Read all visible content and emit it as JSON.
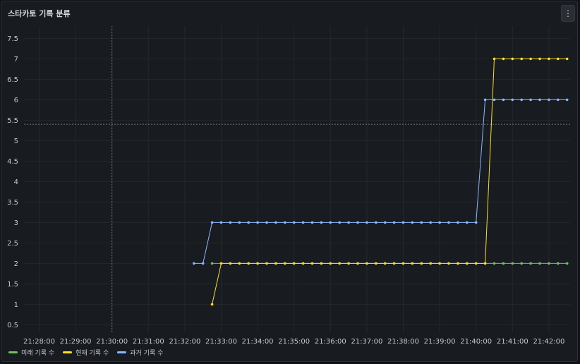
{
  "panel": {
    "title": "스타카토 기록 분류",
    "menu_icon": "more-vertical-icon",
    "menu_glyph": "⋮"
  },
  "chart_data": {
    "type": "line",
    "title": "스타카토 기록 분류",
    "xlabel": "",
    "ylabel": "",
    "x_ticks": [
      "21:28:00",
      "21:29:00",
      "21:30:00",
      "21:31:00",
      "21:32:00",
      "21:33:00",
      "21:34:00",
      "21:35:00",
      "21:36:00",
      "21:37:00",
      "21:38:00",
      "21:39:00",
      "21:40:00",
      "21:41:00",
      "21:42:00"
    ],
    "y_ticks": [
      "0.5",
      "1",
      "1.5",
      "2",
      "2.5",
      "3",
      "3.5",
      "4",
      "4.5",
      "5",
      "5.5",
      "6",
      "6.5",
      "7",
      "7.5"
    ],
    "ylim": [
      0.3,
      7.8
    ],
    "xlim": [
      "21:27:35",
      "21:42:35"
    ],
    "grid": true,
    "legend_position": "bottom-left",
    "series": [
      {
        "name": "미래 기록 수",
        "color": "#73bf69",
        "points": [
          [
            "21:32:45",
            2
          ],
          [
            "21:40:15",
            2
          ],
          [
            "21:40:30",
            2
          ],
          [
            "21:40:45",
            2
          ],
          [
            "21:41:00",
            2
          ],
          [
            "21:41:15",
            2
          ],
          [
            "21:41:30",
            2
          ],
          [
            "21:41:45",
            2
          ],
          [
            "21:42:00",
            2
          ],
          [
            "21:42:15",
            2
          ],
          [
            "21:42:30",
            2
          ]
        ]
      },
      {
        "name": "현재 기록 수",
        "color": "#fade2a",
        "points": [
          [
            "21:32:45",
            1
          ],
          [
            "21:33:00",
            2
          ],
          [
            "21:33:15",
            2
          ],
          [
            "21:33:30",
            2
          ],
          [
            "21:33:45",
            2
          ],
          [
            "21:34:00",
            2
          ],
          [
            "21:34:15",
            2
          ],
          [
            "21:34:30",
            2
          ],
          [
            "21:34:45",
            2
          ],
          [
            "21:35:00",
            2
          ],
          [
            "21:35:15",
            2
          ],
          [
            "21:35:30",
            2
          ],
          [
            "21:35:45",
            2
          ],
          [
            "21:36:00",
            2
          ],
          [
            "21:36:15",
            2
          ],
          [
            "21:36:30",
            2
          ],
          [
            "21:36:45",
            2
          ],
          [
            "21:37:00",
            2
          ],
          [
            "21:37:15",
            2
          ],
          [
            "21:37:30",
            2
          ],
          [
            "21:37:45",
            2
          ],
          [
            "21:38:00",
            2
          ],
          [
            "21:38:15",
            2
          ],
          [
            "21:38:30",
            2
          ],
          [
            "21:38:45",
            2
          ],
          [
            "21:39:00",
            2
          ],
          [
            "21:39:15",
            2
          ],
          [
            "21:39:30",
            2
          ],
          [
            "21:39:45",
            2
          ],
          [
            "21:40:00",
            2
          ],
          [
            "21:40:15",
            2
          ],
          [
            "21:40:30",
            7
          ],
          [
            "21:40:45",
            7
          ],
          [
            "21:41:00",
            7
          ],
          [
            "21:41:15",
            7
          ],
          [
            "21:41:30",
            7
          ],
          [
            "21:41:45",
            7
          ],
          [
            "21:42:00",
            7
          ],
          [
            "21:42:15",
            7
          ],
          [
            "21:42:30",
            7
          ]
        ]
      },
      {
        "name": "과거 기록 수",
        "color": "#8ab8ff",
        "points": [
          [
            "21:32:15",
            2
          ],
          [
            "21:32:30",
            2
          ],
          [
            "21:32:45",
            3
          ],
          [
            "21:33:00",
            3
          ],
          [
            "21:33:15",
            3
          ],
          [
            "21:33:30",
            3
          ],
          [
            "21:33:45",
            3
          ],
          [
            "21:34:00",
            3
          ],
          [
            "21:34:15",
            3
          ],
          [
            "21:34:30",
            3
          ],
          [
            "21:34:45",
            3
          ],
          [
            "21:35:00",
            3
          ],
          [
            "21:35:15",
            3
          ],
          [
            "21:35:30",
            3
          ],
          [
            "21:35:45",
            3
          ],
          [
            "21:36:00",
            3
          ],
          [
            "21:36:15",
            3
          ],
          [
            "21:36:30",
            3
          ],
          [
            "21:36:45",
            3
          ],
          [
            "21:37:00",
            3
          ],
          [
            "21:37:15",
            3
          ],
          [
            "21:37:30",
            3
          ],
          [
            "21:37:45",
            3
          ],
          [
            "21:38:00",
            3
          ],
          [
            "21:38:15",
            3
          ],
          [
            "21:38:30",
            3
          ],
          [
            "21:38:45",
            3
          ],
          [
            "21:39:00",
            3
          ],
          [
            "21:39:15",
            3
          ],
          [
            "21:39:30",
            3
          ],
          [
            "21:39:45",
            3
          ],
          [
            "21:40:00",
            3
          ],
          [
            "21:40:15",
            6
          ],
          [
            "21:40:30",
            6
          ],
          [
            "21:40:45",
            6
          ],
          [
            "21:41:00",
            6
          ],
          [
            "21:41:15",
            6
          ],
          [
            "21:41:30",
            6
          ],
          [
            "21:41:45",
            6
          ],
          [
            "21:42:00",
            6
          ],
          [
            "21:42:15",
            6
          ],
          [
            "21:42:30",
            6
          ]
        ]
      }
    ],
    "crosshair": {
      "x": "21:30:00",
      "y": 5.4
    }
  }
}
